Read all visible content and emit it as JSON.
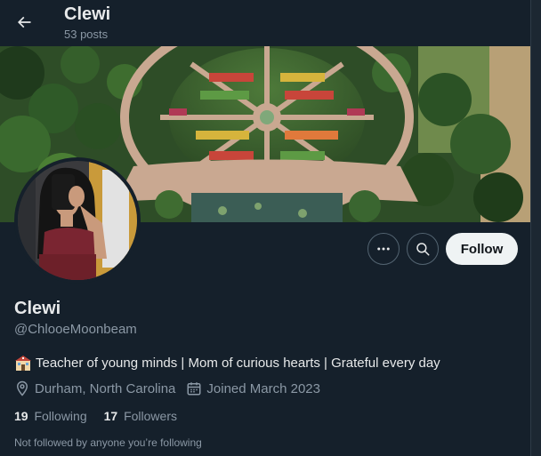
{
  "header": {
    "name": "Clewi",
    "posts": "53 posts"
  },
  "banner": {
    "description_icon": "garden-banner-image"
  },
  "actions": {
    "more_icon": "more-horizontal-icon",
    "search_icon": "search-icon",
    "follow_label": "Follow"
  },
  "profile": {
    "display_name": "Clewi",
    "handle": "@ChlooeMoonbeam",
    "bio": "Teacher of young minds | Mom of curious hearts | Grateful every day",
    "bio_emoji_icon": "school-building-icon",
    "location": "Durham, North Carolina",
    "joined": "Joined March 2023"
  },
  "stats": {
    "following_count": "19",
    "following_label": "Following",
    "followers_count": "17",
    "followers_label": "Followers"
  },
  "footer_note": "Not followed by anyone you’re following",
  "colors": {
    "background": "#15202b",
    "text_primary": "#e7e9ea",
    "text_secondary": "#8b98a5",
    "follow_button_bg": "#eff3f4",
    "border": "#536471"
  }
}
